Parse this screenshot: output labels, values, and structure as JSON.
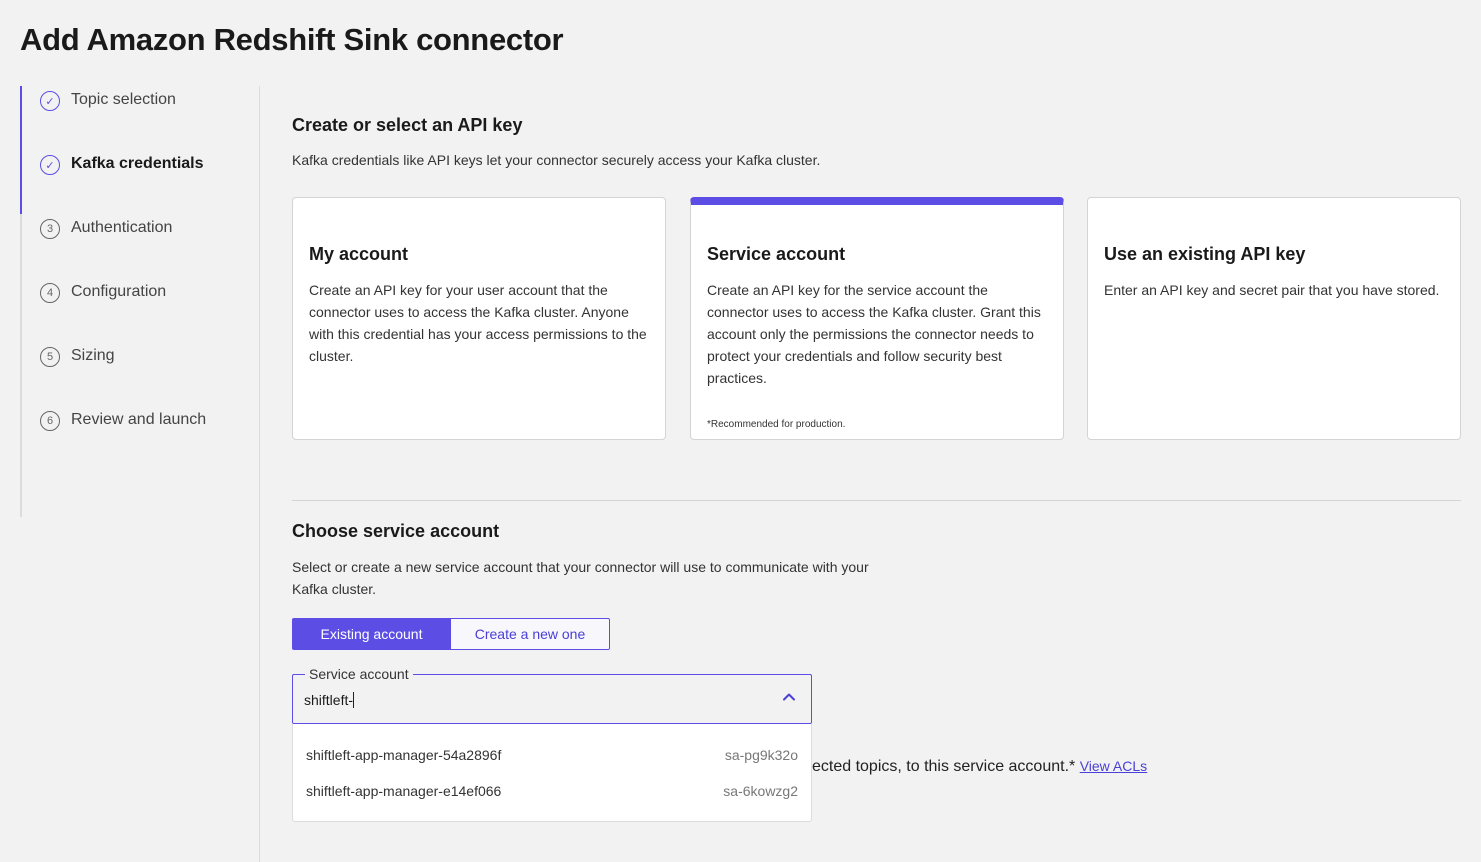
{
  "page": {
    "title": "Add Amazon Redshift Sink connector"
  },
  "stepper": {
    "steps": [
      {
        "label": "Topic selection",
        "marker": "✓"
      },
      {
        "label": "Kafka credentials",
        "marker": "✓"
      },
      {
        "label": "Authentication",
        "marker": "3"
      },
      {
        "label": "Configuration",
        "marker": "4"
      },
      {
        "label": "Sizing",
        "marker": "5"
      },
      {
        "label": "Review and launch",
        "marker": "6"
      }
    ]
  },
  "api_key": {
    "title": "Create or select an API key",
    "description": "Kafka credentials like API keys let your connector securely access your Kafka cluster.",
    "cards": [
      {
        "title": "My account",
        "description": "Create an API key for your user account that the connector uses to access the Kafka cluster. Anyone with this credential has your access permissions to the cluster."
      },
      {
        "title": "Service account",
        "description": "Create an API key for the service account the connector uses to access the Kafka cluster. Grant this account only the permissions the connector needs to protect your credentials and follow security best practices.",
        "note": "*Recommended for production."
      },
      {
        "title": "Use an existing API key",
        "description": "Enter an API key and secret pair that you have stored."
      }
    ]
  },
  "service_account": {
    "title": "Choose service account",
    "description": "Select or create a new service account that your connector will use to communicate with your Kafka cluster.",
    "toggle": {
      "existing": "Existing account",
      "create": "Create a new one"
    },
    "field_label": "Service account",
    "field_value": "shiftleft-",
    "options": [
      {
        "name": "shiftleft-app-manager-54a2896f",
        "id": "sa-pg9k32o"
      },
      {
        "name": "shiftleft-app-manager-e14ef066",
        "id": "sa-6kowzg2"
      }
    ],
    "acl_text": "ected topics, to this service account.*",
    "acl_link": "View ACLs"
  },
  "colors": {
    "accent": "#5c4ee5",
    "background": "#f2f2f2"
  }
}
